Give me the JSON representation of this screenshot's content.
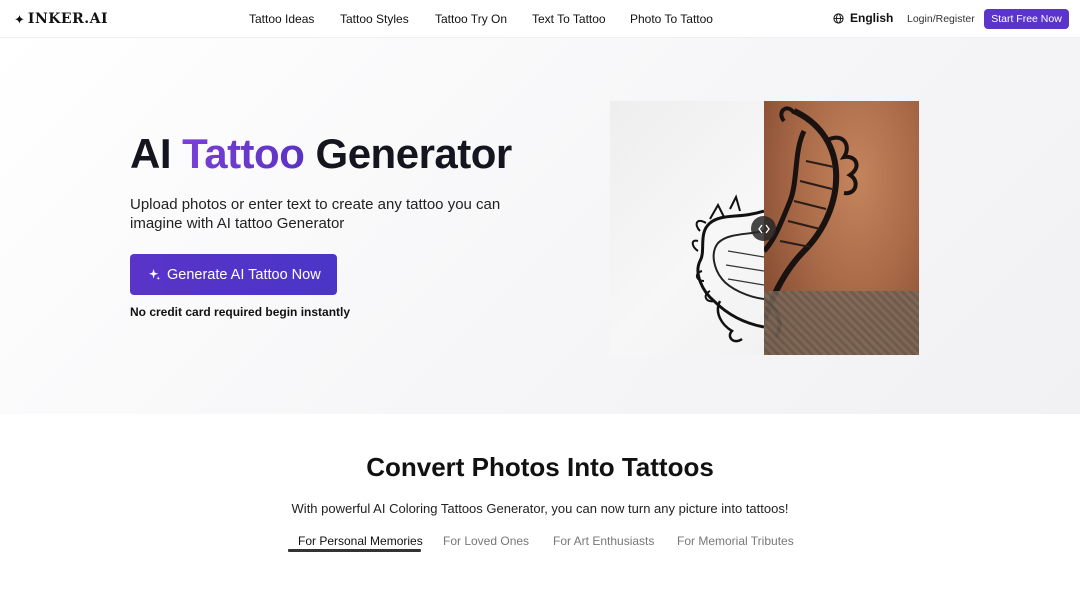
{
  "header": {
    "logo_text": "INKER.AI",
    "logo_icon": "sparkle-icon",
    "nav": [
      "Tattoo Ideas",
      "Tattoo Styles",
      "Tattoo Try On",
      "Text To Tattoo",
      "Photo To Tattoo"
    ],
    "language": "English",
    "language_icon": "globe-icon",
    "login_label": "Login/Register",
    "start_label": "Start Free Now"
  },
  "hero": {
    "title_pre": "AI",
    "title_accent": "Tattoo",
    "title_post": "Generator",
    "subtitle": "Upload photos or enter text to create any tattoo you can imagine with AI tattoo Generator",
    "cta_label": "Generate AI Tattoo Now",
    "cta_icon": "sparkle-icon",
    "note": "No credit card required begin instantly",
    "compare_handle_icon": "code-arrows-icon"
  },
  "convert": {
    "title": "Convert Photos Into Tattoos",
    "subtitle": "With powerful AI Coloring Tattoos Generator, you can now turn any picture into tattoos!",
    "tabs": [
      "For Personal Memories",
      "For Loved Ones",
      "For Art Enthusiasts",
      "For Memorial Tributes"
    ],
    "active_tab": "For Personal Memories"
  },
  "colors": {
    "accent": "#5b35c9",
    "accent_gradient_start": "#7a3fd6"
  }
}
